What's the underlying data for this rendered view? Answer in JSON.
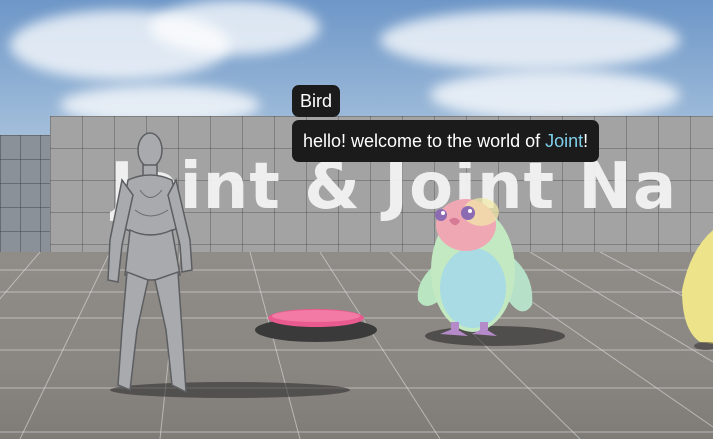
{
  "dialogue": {
    "speaker": "Bird",
    "message_prefix": "hello! welcome to the world of ",
    "message_highlight": "Joint",
    "message_suffix": "!"
  },
  "wall_sign": {
    "text": "Joint & Joint Na"
  },
  "colors": {
    "dialogue_background": "#1b1b1b",
    "dialogue_text": "#ffffff",
    "highlight_text": "#7fd0ea",
    "pad_color": "#e95a8e"
  }
}
